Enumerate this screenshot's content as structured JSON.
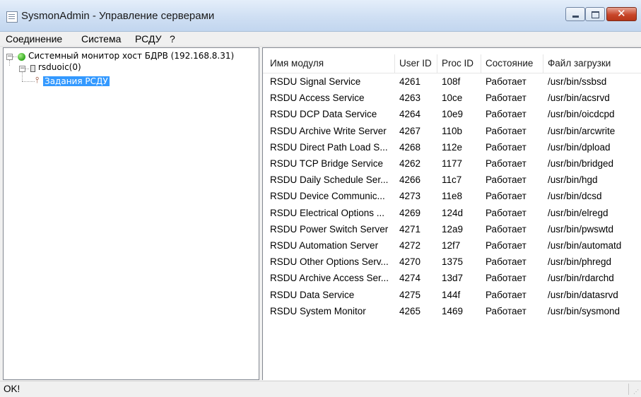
{
  "window": {
    "title": "SysmonAdmin - Управление серверами",
    "controls": {
      "minimize": "▬",
      "maximize": "□",
      "close": "✕"
    }
  },
  "menu": [
    "Соединение",
    "Система",
    "РСДУ",
    "?"
  ],
  "tree": {
    "root": {
      "label": "Системный монитор хост БДРВ (192.168.8.31)",
      "expander": "−",
      "icon": "status-online-icon"
    },
    "host": {
      "label": "rsduoic(0)",
      "expander": "−",
      "icon": "server-icon"
    },
    "task": {
      "label": "Задания РСДУ",
      "icon": "task-icon",
      "selected": true
    }
  },
  "list": {
    "columns": [
      "Имя модуля",
      "User ID",
      "Proc ID",
      "Состояние",
      "Файл загрузки"
    ],
    "rows": [
      [
        "RSDU Signal Service",
        "4261",
        "108f",
        "Работает",
        "/usr/bin/ssbsd"
      ],
      [
        "RSDU Access Service",
        "4263",
        "10ce",
        "Работает",
        "/usr/bin/acsrvd"
      ],
      [
        "RSDU DCP Data Service",
        "4264",
        "10e9",
        "Работает",
        "/usr/bin/oicdcpd"
      ],
      [
        "RSDU Archive Write Server",
        "4267",
        "110b",
        "Работает",
        "/usr/bin/arcwrite"
      ],
      [
        "RSDU Direct Path Load S...",
        "4268",
        "112e",
        "Работает",
        "/usr/bin/dpload"
      ],
      [
        "RSDU TCP Bridge Service",
        "4262",
        "1177",
        "Работает",
        "/usr/bin/bridged"
      ],
      [
        "RSDU Daily Schedule Ser...",
        "4266",
        "11c7",
        "Работает",
        "/usr/bin/hgd"
      ],
      [
        "RSDU Device Communic...",
        "4273",
        "11e8",
        "Работает",
        "/usr/bin/dcsd"
      ],
      [
        "RSDU Electrical Options ...",
        "4269",
        "124d",
        "Работает",
        "/usr/bin/elregd"
      ],
      [
        "RSDU Power Switch Server",
        "4271",
        "12a9",
        "Работает",
        "/usr/bin/pwswtd"
      ],
      [
        "RSDU Automation Server",
        "4272",
        "12f7",
        "Работает",
        "/usr/bin/automatd"
      ],
      [
        "RSDU Other Options Serv...",
        "4270",
        "1375",
        "Работает",
        "/usr/bin/phregd"
      ],
      [
        "RSDU Archive Access Ser...",
        "4274",
        "13d7",
        "Работает",
        "/usr/bin/rdarchd"
      ],
      [
        "RSDU Data Service",
        "4275",
        "144f",
        "Работает",
        "/usr/bin/datasrvd"
      ],
      [
        "RSDU System Monitor",
        "4265",
        "1469",
        "Работает",
        "/usr/bin/sysmond"
      ]
    ]
  },
  "status": {
    "text": "OK!"
  }
}
